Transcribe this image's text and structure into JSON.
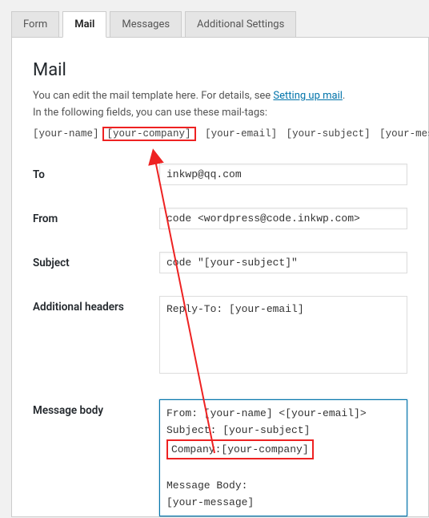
{
  "tabs": {
    "form": "Form",
    "mail": "Mail",
    "messages": "Messages",
    "additional": "Additional Settings"
  },
  "section_title": "Mail",
  "intro_line1_a": "You can edit the mail template here. For details, see ",
  "intro_link": "Setting up mail",
  "intro_line1_b": ".",
  "intro_line2": "In the following fields, you can use these mail-tags:",
  "tags": {
    "your_name": "[your-name]",
    "your_company": "[your-company]",
    "your_email": "[your-email]",
    "your_subject": "[your-subject]",
    "your_message": "[your-message]"
  },
  "fields": {
    "to": {
      "label": "To",
      "value": "inkwp@qq.com"
    },
    "from": {
      "label": "From",
      "value": "code <wordpress@code.inkwp.com>"
    },
    "subject": {
      "label": "Subject",
      "value": "code \"[your-subject]\""
    },
    "headers": {
      "label": "Additional headers",
      "value": "Reply-To: [your-email]"
    },
    "body": {
      "label": "Message body",
      "line1": "From: [your-name] <[your-email]>",
      "line2": "Subject: [your-subject]",
      "line3": "Company:[your-company]",
      "line4_a": "Message Body:",
      "line4_b": "[your-message]"
    }
  }
}
